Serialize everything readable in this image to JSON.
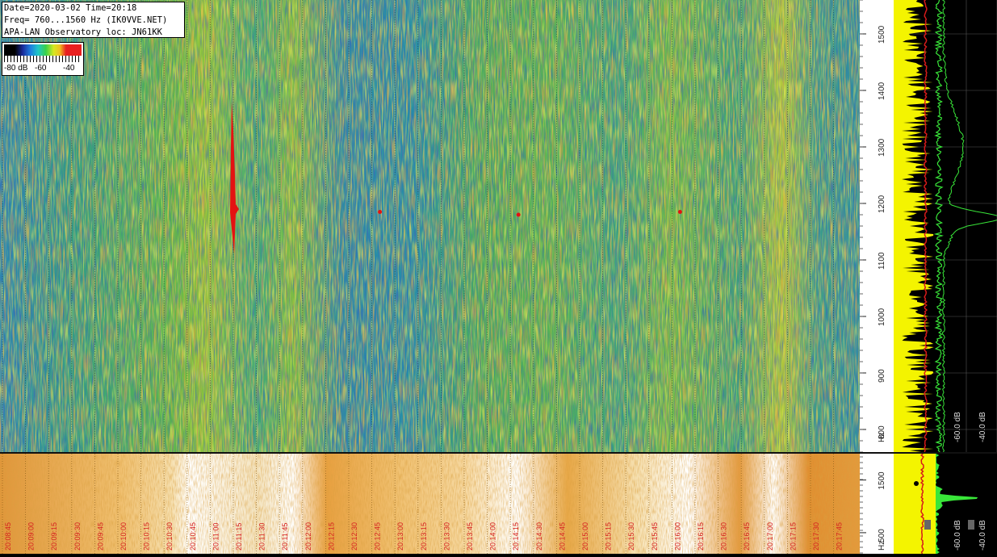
{
  "header": {
    "line1": "Date=2020-03-02 Time=20:18",
    "line2": "Freq= 760...1560 Hz (IK0VVE.NET)",
    "line3": "APA-LAN Observatory loc: JN61KK"
  },
  "legend": {
    "label_min": "-80 dB",
    "label_mid": "-60",
    "label_max": "-40"
  },
  "colors": {
    "spectro_bg": "#2fa37a",
    "signal_red": "#e41212",
    "lower_bg": "#e9a43a",
    "spectrum_green": "#39e639",
    "spectrum_yellow": "#f4f400",
    "avg_red": "#d61a1a"
  },
  "chart_data": [
    {
      "type": "heatmap",
      "title": "",
      "xlabel": "",
      "ylabel": "Hz",
      "ylim": [
        760,
        1560
      ],
      "y_ticks": [
        800,
        900,
        1000,
        1100,
        1200,
        1300,
        1400,
        1500
      ],
      "y_unit": "Hz",
      "color_scale_db": [
        -80,
        -60,
        -40
      ],
      "vertical_signal": {
        "x_time": "20:11:15",
        "freq_min": 1110,
        "freq_max": 1380,
        "peak_freq": 1190
      },
      "small_signals": [
        {
          "x_time": "20:14:15",
          "freq": 1180
        },
        {
          "x_time": "20:16:00",
          "freq": 1185
        },
        {
          "x_time": "20:12:45",
          "freq": 1185
        }
      ]
    },
    {
      "type": "heatmap",
      "title": "",
      "x_times": [
        "20:08:45",
        "20:09:00",
        "20:09:15",
        "20:09:30",
        "20:09:45",
        "20:10:00",
        "20:10:15",
        "20:10:30",
        "20:10:45",
        "20:11:00",
        "20:11:15",
        "20:11:30",
        "20:11:45",
        "20:12:00",
        "20:12:15",
        "20:12:30",
        "20:12:45",
        "20:13:00",
        "20:13:15",
        "20:13:30",
        "20:13:45",
        "20:14:00",
        "20:14:15",
        "20:14:30",
        "20:14:45",
        "20:15:00",
        "20:15:15",
        "20:15:30",
        "20:15:45",
        "20:16:00",
        "20:16:15",
        "20:16:30",
        "20:16:45",
        "20:17:00",
        "20:17:15",
        "20:17:30",
        "20:17:45"
      ],
      "y_ticks": [
        500,
        1500
      ],
      "y_unit": "Hz"
    },
    {
      "type": "line",
      "title": "",
      "xlabel": "dB",
      "x_ticks": [
        -60,
        -40
      ],
      "x_tick_labels": [
        "-60.0 dB",
        "-40.0 dB"
      ],
      "ylim": [
        760,
        1560
      ],
      "series": [
        {
          "name": "",
          "peak_freq": 1175,
          "peak_db": -41
        }
      ]
    }
  ]
}
